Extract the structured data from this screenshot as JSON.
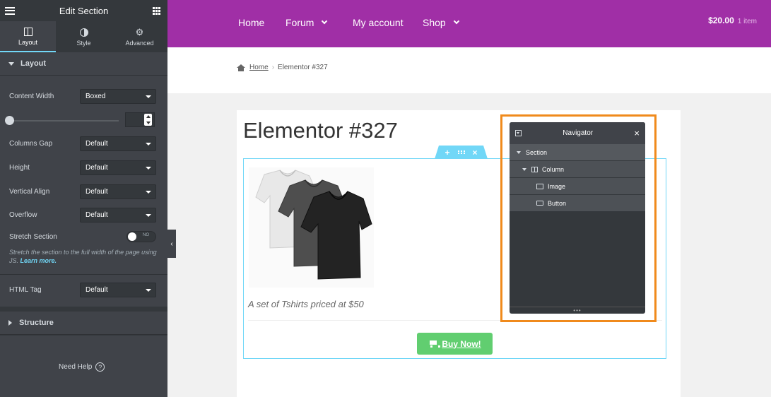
{
  "panel": {
    "title": "Edit Section",
    "tabs": [
      {
        "label": "Layout",
        "icon": "columns-icon"
      },
      {
        "label": "Style",
        "icon": "half-circle-icon"
      },
      {
        "label": "Advanced",
        "icon": "gear-icon"
      }
    ],
    "layout_heading": "Layout",
    "content_width": {
      "label": "Content Width",
      "value": "Boxed"
    },
    "columns_gap": {
      "label": "Columns Gap",
      "value": "Default"
    },
    "height": {
      "label": "Height",
      "value": "Default"
    },
    "vertical_align": {
      "label": "Vertical Align",
      "value": "Default"
    },
    "overflow": {
      "label": "Overflow",
      "value": "Default"
    },
    "stretch_section": {
      "label": "Stretch Section",
      "toggle_text": "NO",
      "description": "Stretch the section to the full width of the page using JS.",
      "learn_more": "Learn more."
    },
    "html_tag": {
      "label": "HTML Tag",
      "value": "Default"
    },
    "structure_heading": "Structure",
    "need_help": "Need Help",
    "help_glyph": "?"
  },
  "site": {
    "nav": [
      {
        "label": "Home",
        "has_dropdown": false
      },
      {
        "label": "Forum",
        "has_dropdown": true
      },
      {
        "label": "My account",
        "has_dropdown": false
      },
      {
        "label": "Shop",
        "has_dropdown": true
      }
    ],
    "cart_total": "$20.00",
    "cart_items": "1 item",
    "breadcrumb": {
      "home": "Home",
      "sep": "›",
      "current": "Elementor #327"
    },
    "page_title": "Elementor #327",
    "caption": "A set of Tshirts priced at $50",
    "buy_button": "Buy Now!",
    "colors": {
      "nav_bg": "#a02fa6",
      "button": "#61ce70",
      "accent": "#71d7f7",
      "highlight": "#f08a1c"
    }
  },
  "section_handle": {
    "add": "+",
    "close": "×"
  },
  "navigator": {
    "title": "Navigator",
    "close": "×",
    "footer": "•••",
    "items": [
      {
        "label": "Section"
      },
      {
        "label": "Column"
      },
      {
        "label": "Image"
      },
      {
        "label": "Button"
      }
    ]
  }
}
